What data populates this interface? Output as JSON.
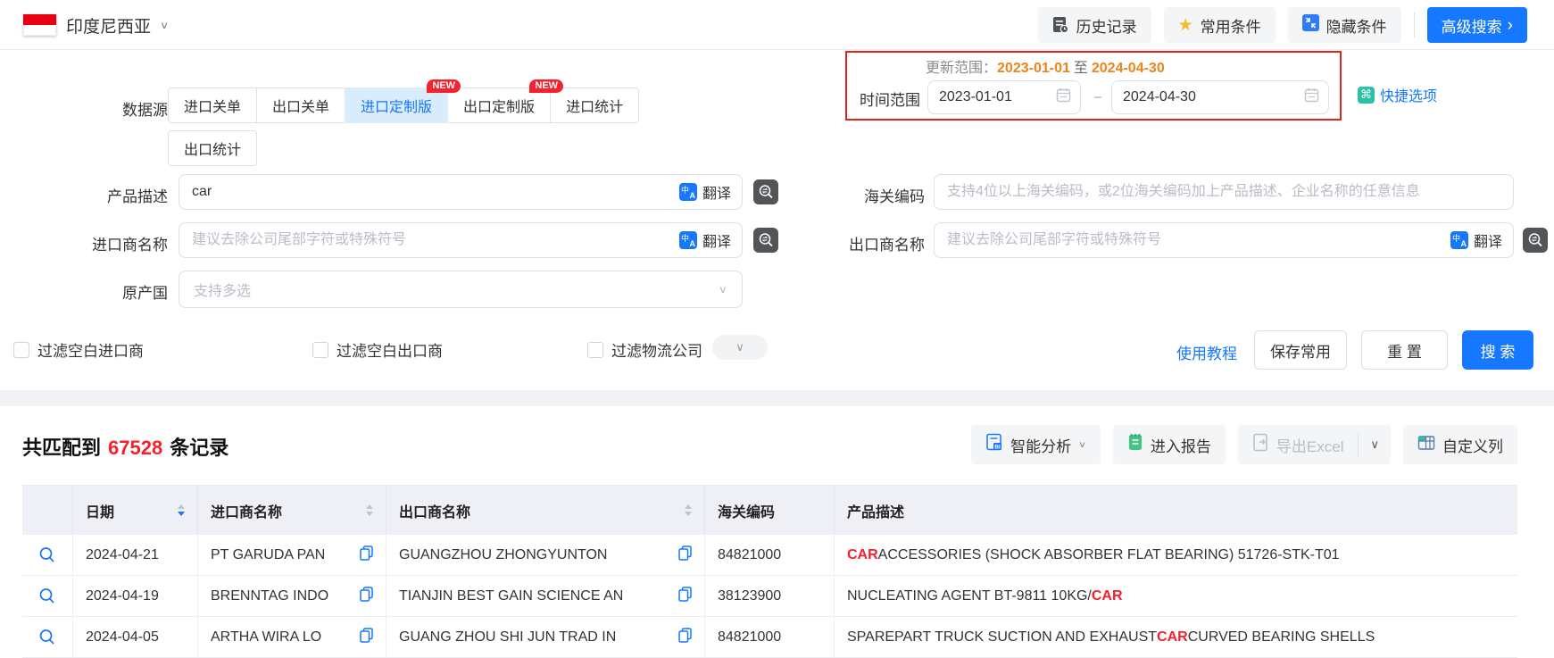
{
  "topbar": {
    "country": "印度尼西亚",
    "history": "历史记录",
    "favorites": "常用条件",
    "hide_conditions": "隐藏条件",
    "advanced_search": "高级搜索"
  },
  "form": {
    "datasource": {
      "label": "数据源",
      "tabs": [
        {
          "label": "进口关单"
        },
        {
          "label": "出口关单"
        },
        {
          "label": "进口定制版",
          "badge": "NEW"
        },
        {
          "label": "出口定制版",
          "badge": "NEW"
        },
        {
          "label": "进口统计"
        },
        {
          "label": "出口统计"
        }
      ]
    },
    "update_range": {
      "label": "更新范围：",
      "start": "2023-01-01",
      "to": "至",
      "end": "2024-04-30"
    },
    "time_range": {
      "label": "时间范围",
      "start": "2023-01-01",
      "dash": "–",
      "end": "2024-04-30"
    },
    "quick_options": "快捷选项",
    "product_desc": {
      "label": "产品描述",
      "value": "car",
      "translate": "翻译"
    },
    "hs_code": {
      "label": "海关编码",
      "placeholder": "支持4位以上海关编码，或2位海关编码加上产品描述、企业名称的任意信息"
    },
    "importer": {
      "label": "进口商名称",
      "placeholder": "建议去除公司尾部字符或特殊符号",
      "translate": "翻译"
    },
    "exporter": {
      "label": "出口商名称",
      "placeholder": "建议去除公司尾部字符或特殊符号",
      "translate": "翻译"
    },
    "origin_country": {
      "label": "原产国",
      "placeholder": "支持多选"
    },
    "filters": [
      "过滤空白进口商",
      "过滤空白出口商",
      "过滤物流公司"
    ],
    "tutorial_link": "使用教程",
    "save_button": "保存常用",
    "reset_button": "重 置",
    "search_button": "搜 索"
  },
  "results": {
    "prefix": "共匹配到",
    "count": "67528",
    "suffix": "条记录",
    "smart_analysis": "智能分析",
    "enter_report": "进入报告",
    "export_excel": "导出Excel",
    "custom_columns": "自定义列"
  },
  "table": {
    "headers": {
      "date": "日期",
      "importer": "进口商名称",
      "exporter": "出口商名称",
      "hs_code": "海关编码",
      "product_desc": "产品描述"
    },
    "rows": [
      {
        "date": "2024-04-21",
        "importer": "PT GARUDA PAN",
        "exporter": "GUANGZHOU ZHONGYUNTON",
        "hs": "84821000",
        "desc": [
          {
            "t": "CAR",
            "hl": true
          },
          {
            "t": " ACCESSORIES (SHOCK ABSORBER FLAT BEARING) 51726-STK-T01",
            "hl": false
          }
        ]
      },
      {
        "date": "2024-04-19",
        "importer": "BRENNTAG INDO",
        "exporter": "TIANJIN BEST GAIN SCIENCE AN",
        "hs": "38123900",
        "desc": [
          {
            "t": "NUCLEATING AGENT BT-9811 10KG/",
            "hl": false
          },
          {
            "t": "CAR",
            "hl": true
          }
        ]
      },
      {
        "date": "2024-04-05",
        "importer": "ARTHA WIRA LO",
        "exporter": "GUANG ZHOU SHI JUN TRAD IN",
        "hs": "84821000",
        "desc": [
          {
            "t": "SPAREPART TRUCK SUCTION AND EXHAUST ",
            "hl": false
          },
          {
            "t": "CAR",
            "hl": true
          },
          {
            "t": " CURVED BEARING SHELLS",
            "hl": false
          }
        ]
      }
    ]
  },
  "colors": {
    "accent": "#1677ff",
    "alert_red": "#e02222",
    "highlight_red": "#f5222d",
    "date_orange": "#ef8418",
    "badge_red": "#f5222d"
  }
}
